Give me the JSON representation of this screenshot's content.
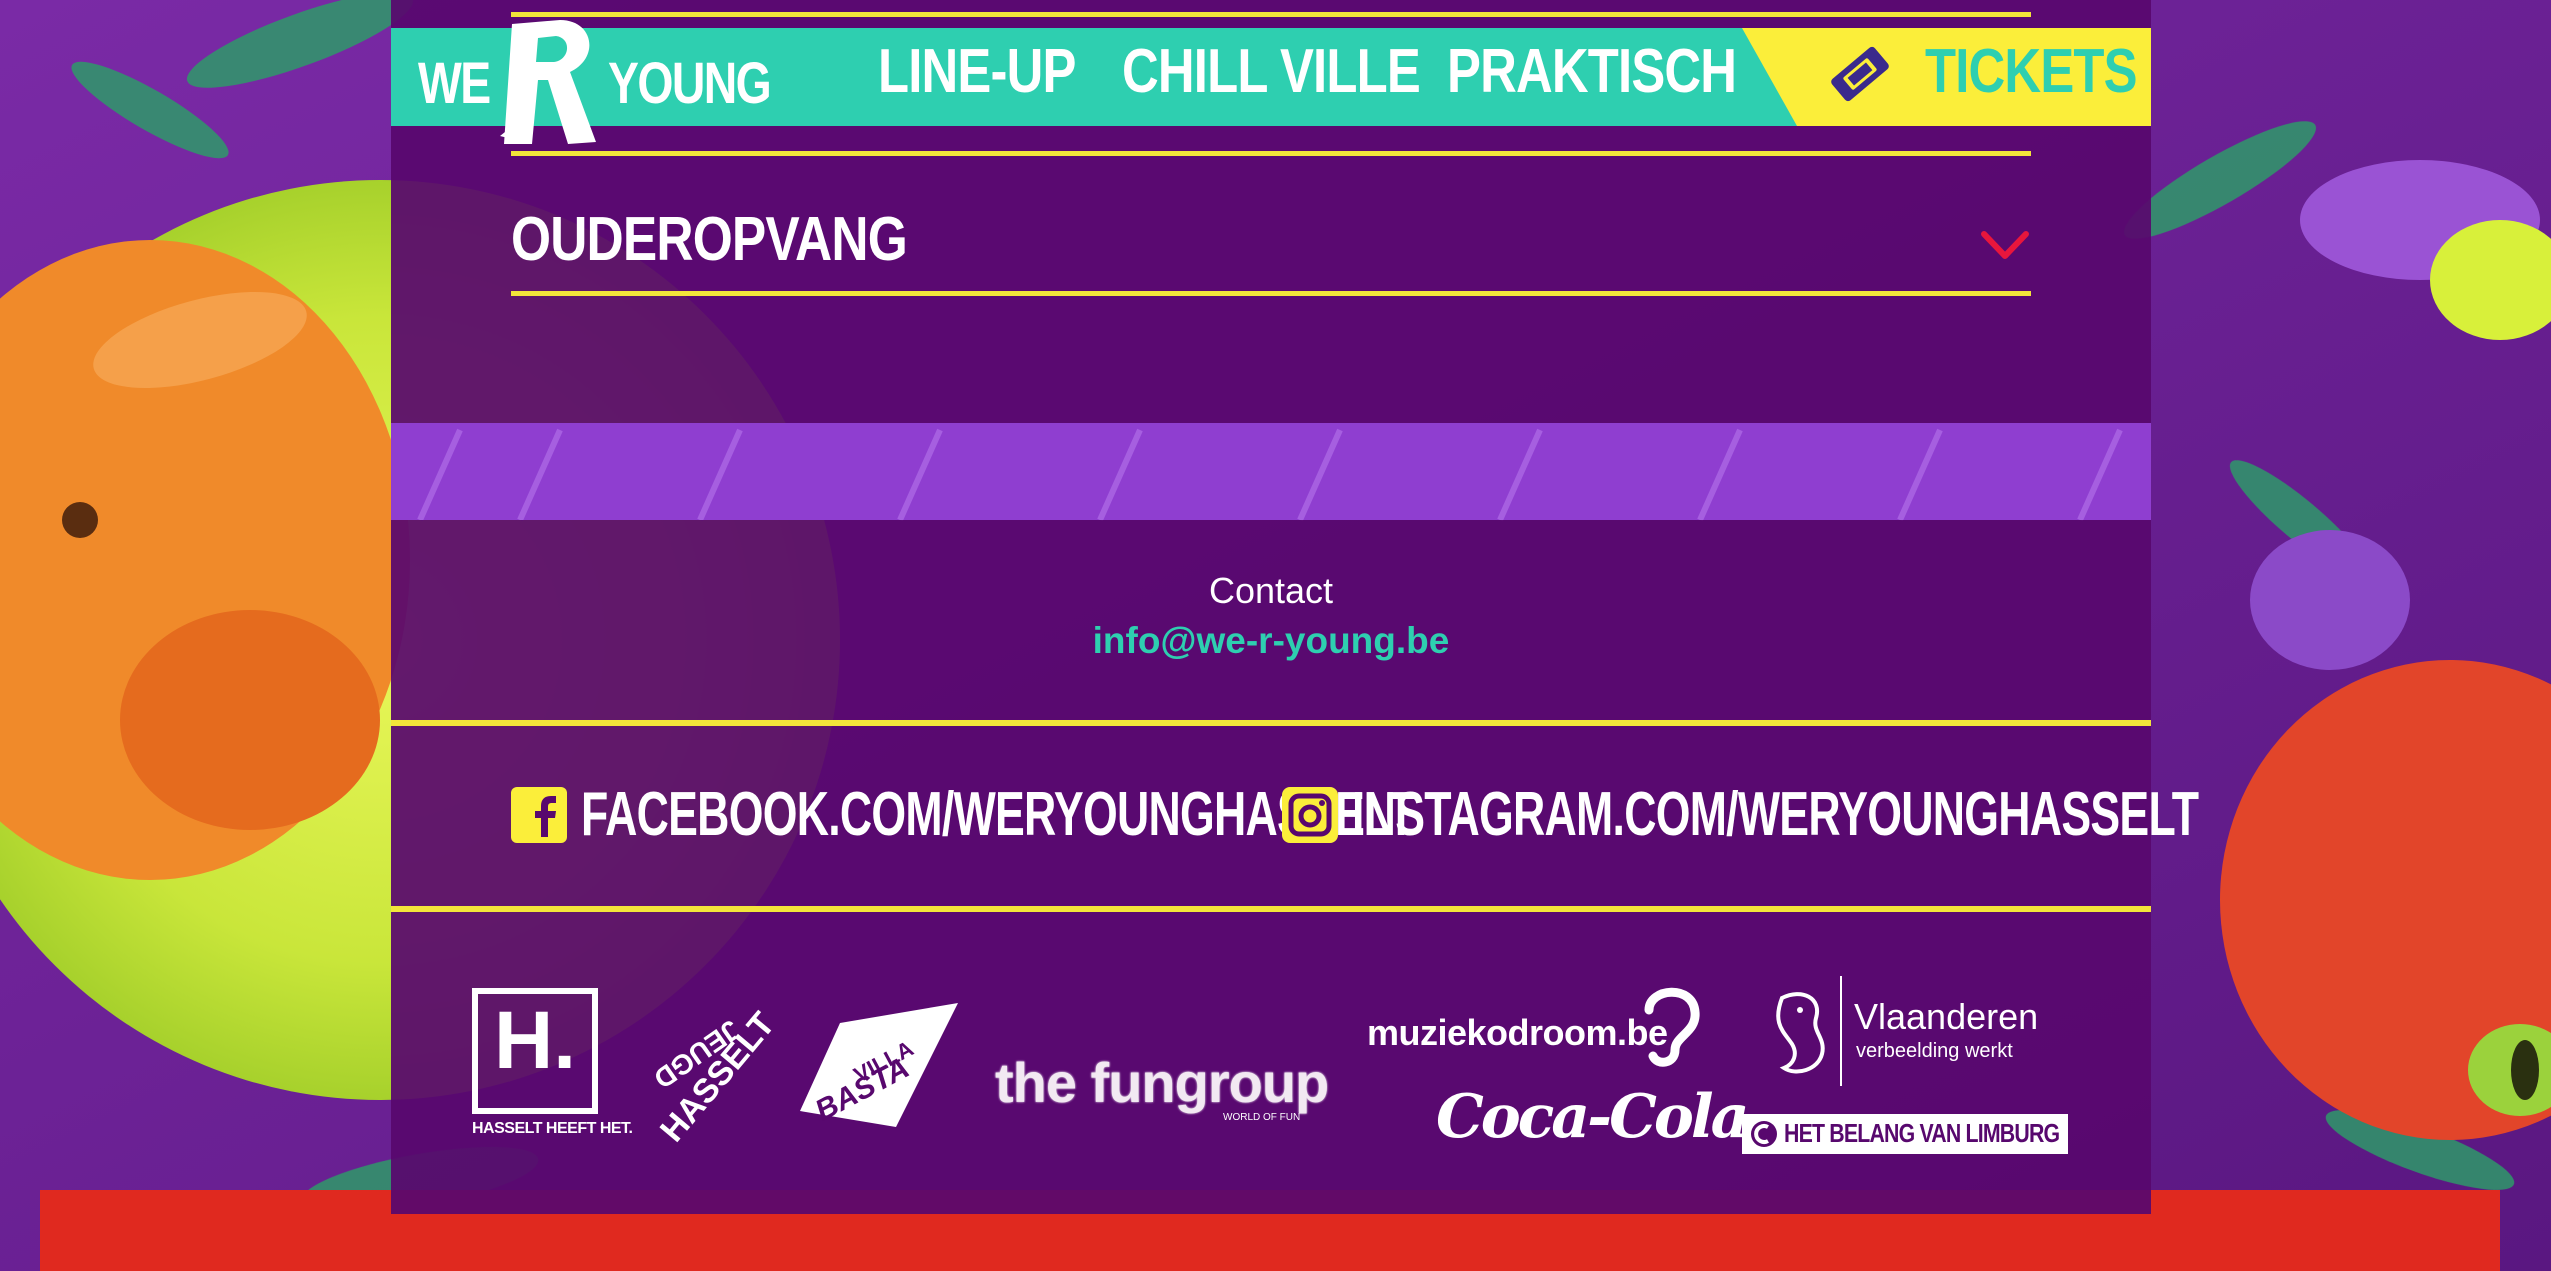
{
  "logo": {
    "we": "WE",
    "r": "R",
    "young": "YOUNG"
  },
  "nav": {
    "items": [
      {
        "label": "LINE-UP"
      },
      {
        "label": "CHILL VILLE"
      },
      {
        "label": "PRAKTISCH"
      }
    ],
    "tickets_label": "TICKETS"
  },
  "accordion": {
    "title": "OUDEROPVANG",
    "icon": "chevron-down-icon"
  },
  "contact": {
    "label": "Contact",
    "email": "info@we-r-young.be"
  },
  "socials": {
    "facebook": "FACEBOOK.COM/WERYOUNGHASSELT",
    "instagram": "INSTAGRAM.COM/WERYOUNGHASSELT"
  },
  "sponsors": {
    "hasselt": {
      "mark": "H.",
      "caption": "HASSELT HEEFT HET."
    },
    "jeugd_hasselt": {
      "line1": "JEUGD",
      "line2": "HASSELT"
    },
    "villa_basta": {
      "line1": "VILLA",
      "line2": "BASTA"
    },
    "fungroup": {
      "name": "the fungroup",
      "tag": "WORLD OF FUN"
    },
    "muziekodroom": "muziekodroom.be",
    "coca_cola": "Coca-Cola",
    "vlaanderen": {
      "name": "Vlaanderen",
      "slogan": "verbeelding werkt"
    },
    "het_belang": "HET BELANG VAN LIMBURG"
  },
  "colors": {
    "teal": "#2ecfb0",
    "yellow": "#fbee3a",
    "panel_purple": "#58086e",
    "chevron_red": "#e8163c"
  }
}
